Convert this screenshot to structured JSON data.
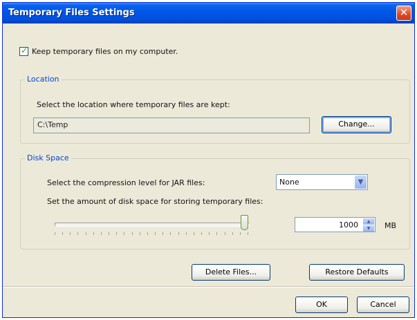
{
  "window": {
    "title": "Temporary Files Settings",
    "close_glyph": "✕"
  },
  "keep_files": {
    "checked": true,
    "check_glyph": "✓",
    "label": "Keep temporary files on my computer."
  },
  "location": {
    "legend": "Location",
    "description": "Select the location where temporary files are kept:",
    "path": "C:\\Temp",
    "change_label": "Change..."
  },
  "disk_space": {
    "legend": "Disk Space",
    "compression_label": "Select the compression level for JAR files:",
    "compression_value": "None",
    "amount_label": "Set the amount of disk space for storing temporary files:",
    "amount_value": "1000",
    "unit": "MB",
    "slider_level_fraction": 0.98
  },
  "buttons": {
    "delete": "Delete Files...",
    "restore": "Restore Defaults",
    "ok": "OK",
    "cancel": "Cancel"
  },
  "icons": {
    "close": "close-icon",
    "checkbox": "check-icon",
    "combo": "chevron-down-icon",
    "spin_up": "spinner-up-icon",
    "spin_down": "spinner-down-icon"
  },
  "colors": {
    "title_bar": "#0054e3",
    "close_button": "#e14b28",
    "group_legend": "#0046d5",
    "dialog_bg": "#ece9d8"
  }
}
